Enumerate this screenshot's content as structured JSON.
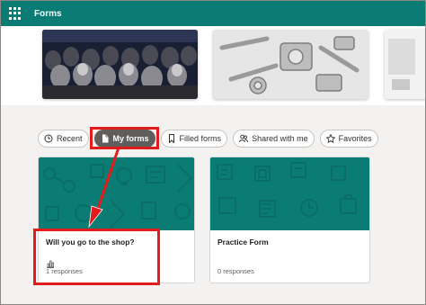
{
  "app": {
    "title": "Forms"
  },
  "tabs": [
    {
      "label": "Recent",
      "icon": "clock-icon"
    },
    {
      "label": "My forms",
      "icon": "document-icon",
      "selected": true
    },
    {
      "label": "Filled forms",
      "icon": "bookmark-icon"
    },
    {
      "label": "Shared with me",
      "icon": "people-icon"
    },
    {
      "label": "Favorites",
      "icon": "star-icon"
    }
  ],
  "forms": [
    {
      "title": "Will you go to the shop?",
      "responses": "1 responses",
      "icon": "bar-chart-icon"
    },
    {
      "title": "Practice Form",
      "responses": "0 responses"
    }
  ],
  "colors": {
    "brand": "#0b7c74",
    "highlight": "#e21b1b",
    "active_pill": "#605e5c"
  }
}
